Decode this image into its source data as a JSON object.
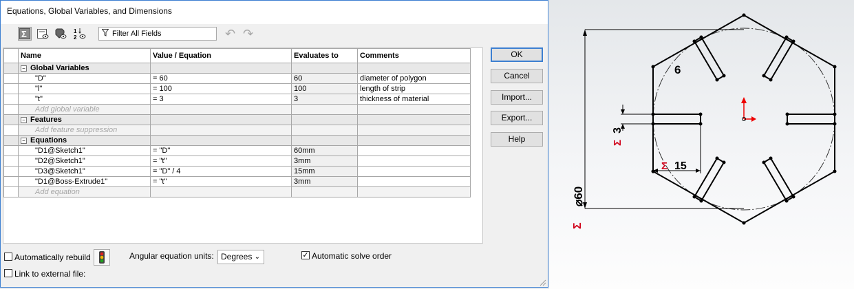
{
  "dialog": {
    "title": "Equations, Global Variables, and Dimensions",
    "filter_placeholder": "Filter All Fields",
    "toolbar": [
      {
        "icon": "sigma-view-icon",
        "active": true
      },
      {
        "icon": "sheet-view-icon",
        "active": false
      },
      {
        "icon": "eye-dimension-icon",
        "active": false
      },
      {
        "icon": "ordered-view-icon",
        "active": false
      }
    ],
    "columns": [
      "Name",
      "Value / Equation",
      "Evaluates to",
      "Comments"
    ],
    "sections": [
      {
        "title": "Global Variables",
        "rows": [
          {
            "name": "\"D\"",
            "value": "= 60",
            "evaluates": "60",
            "comment": "diameter of polygon"
          },
          {
            "name": "\"l\"",
            "value": "= 100",
            "evaluates": "100",
            "comment": "length of strip"
          },
          {
            "name": "\"t\"",
            "value": "= 3",
            "evaluates": "3",
            "comment": "thickness of material"
          }
        ],
        "add_label": "Add global variable"
      },
      {
        "title": "Features",
        "rows": [],
        "add_label": "Add feature suppression"
      },
      {
        "title": "Equations",
        "rows": [
          {
            "name": "\"D1@Sketch1\"",
            "value": "= \"D\"",
            "evaluates": "60mm",
            "comment": ""
          },
          {
            "name": "\"D2@Sketch1\"",
            "value": "= \"t\"",
            "evaluates": "3mm",
            "comment": ""
          },
          {
            "name": "\"D3@Sketch1\"",
            "value": "= \"D\" / 4",
            "evaluates": "15mm",
            "comment": ""
          },
          {
            "name": "\"D1@Boss-Extrude1\"",
            "value": "= \"t\"",
            "evaluates": "3mm",
            "comment": ""
          }
        ],
        "add_label": "Add equation"
      }
    ],
    "buttons": {
      "ok": "OK",
      "cancel": "Cancel",
      "import": "Import...",
      "export": "Export...",
      "help": "Help"
    },
    "bottom": {
      "auto_rebuild": "Automatically rebuild",
      "auto_rebuild_checked": false,
      "angular_units_label": "Angular equation units:",
      "angular_units_value": "Degrees",
      "auto_solve": "Automatic solve order",
      "auto_solve_checked": true,
      "link_external": "Link to external file:",
      "link_external_checked": false
    }
  },
  "sketch": {
    "dim_polygon": "60",
    "dim_thickness": "3",
    "dim_slot": "15",
    "dim_six": "6",
    "accent_color": "#d0021b"
  }
}
